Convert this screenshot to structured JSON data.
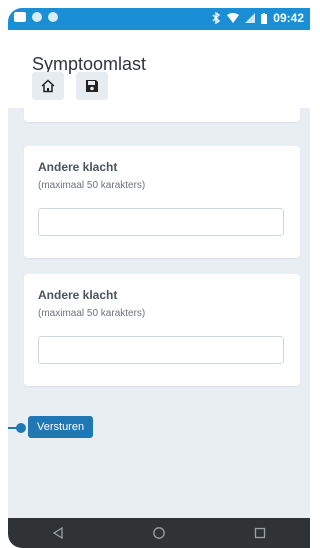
{
  "status_bar": {
    "time": "09:42"
  },
  "app": {
    "title": "Symptoomlast"
  },
  "toolbar": {
    "home_icon": "home-icon",
    "save_icon": "save-icon"
  },
  "form": {
    "cards": [
      {
        "label": "Andere klacht",
        "hint": "(maximaal 50 karakters)",
        "value": "",
        "placeholder": ""
      },
      {
        "label": "Andere klacht",
        "hint": "(maximaal 50 karakters)",
        "value": "",
        "placeholder": ""
      }
    ],
    "submit_label": "Versturen"
  },
  "colors": {
    "status_bar": "#1a8fd6",
    "accent": "#1f77b4",
    "background": "#e9eef2",
    "nav_bar": "#2f3336"
  }
}
